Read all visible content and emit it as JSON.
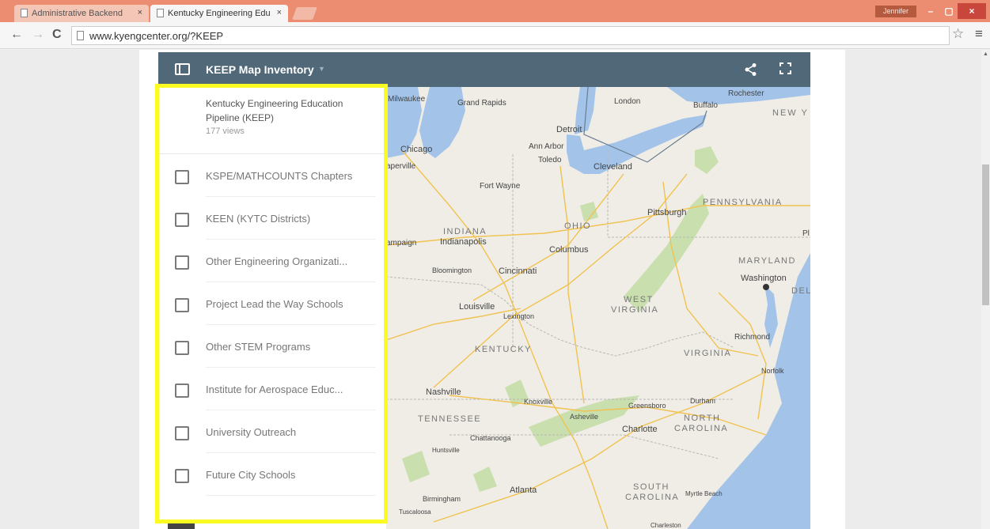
{
  "browser": {
    "tabs": [
      {
        "title": "Administrative Backend"
      },
      {
        "title": "Kentucky Engineering Edu"
      }
    ],
    "tab_close": "×",
    "user": "Jennifer",
    "window": {
      "minimize": "–",
      "maximize": "▢",
      "close": "×"
    },
    "url": "www.kyengcenter.org/?KEEP",
    "nav": {
      "back": "←",
      "forward": "→",
      "reload": "C"
    },
    "bookmark_star": "☆",
    "menu": "≡"
  },
  "map_header": {
    "title": "KEEP Map Inventory",
    "caret": "▼",
    "share_icon": "<"
  },
  "sidebar": {
    "map_title": "Kentucky Engineering Education Pipeline (KEEP)",
    "views": "177 views",
    "layers": [
      {
        "label": "KSPE/MATHCOUNTS Chapters",
        "checked": false
      },
      {
        "label": "KEEN (KYTC Districts)",
        "checked": false
      },
      {
        "label": "Other Engineering Organizati...",
        "checked": false
      },
      {
        "label": "Project Lead the Way Schools",
        "checked": false
      },
      {
        "label": "Other STEM Programs",
        "checked": false
      },
      {
        "label": "Institute for Aerospace Educ...",
        "checked": false
      },
      {
        "label": "University Outreach",
        "checked": false
      },
      {
        "label": "Future City Schools",
        "checked": false
      }
    ]
  },
  "map": {
    "labels": {
      "milwaukee": "Milwaukee",
      "grand_rapids": "Grand Rapids",
      "london": "London",
      "buffalo": "Buffalo",
      "rochester": "Rochester",
      "new_york": "NEW Y",
      "detroit": "Detroit",
      "chicago": "Chicago",
      "ann_arbor": "Ann Arbor",
      "naperville": "aperville",
      "toledo": "Toledo",
      "cleveland": "Cleveland",
      "fort_wayne": "Fort Wayne",
      "pennsylvania": "PENNSYLVANIA",
      "pittsburgh": "Pittsburgh",
      "ohio": "OHIO",
      "indiana": "INDIANA",
      "indianapolis": "Indianapolis",
      "champaign": "ampaign",
      "columbus": "Columbus",
      "pl": "Pl",
      "maryland": "MARYLAND",
      "bloomington": "Bloomington",
      "cincinnati": "Cincinnati",
      "washington": "Washington",
      "del": "DEL",
      "louisville": "Louisville",
      "west_virginia_1": "WEST",
      "west_virginia_2": "VIRGINIA",
      "lexington": "Lexington",
      "richmond": "Richmond",
      "kentucky": "KENTUCKY",
      "virginia": "VIRGINIA",
      "norfolk": "Norfolk",
      "nashville": "Nashville",
      "knoxville": "Knoxville",
      "greensboro": "Greensboro",
      "durham": "Durham",
      "tennessee": "TENNESSEE",
      "asheville": "Asheville",
      "north": "NORTH",
      "charlotte": "Charlotte",
      "carolina": "CAROLINA",
      "chattanooga": "Chattanooga",
      "huntsville": "Huntsville",
      "atlanta": "Atlanta",
      "south": "SOUTH",
      "south_carolina": "CAROLINA",
      "myrtle_beach": "Myrtle Beach",
      "birmingham": "Birmingham",
      "tuscaloosa": "Tuscaloosa",
      "charleston": "Charleston"
    }
  }
}
